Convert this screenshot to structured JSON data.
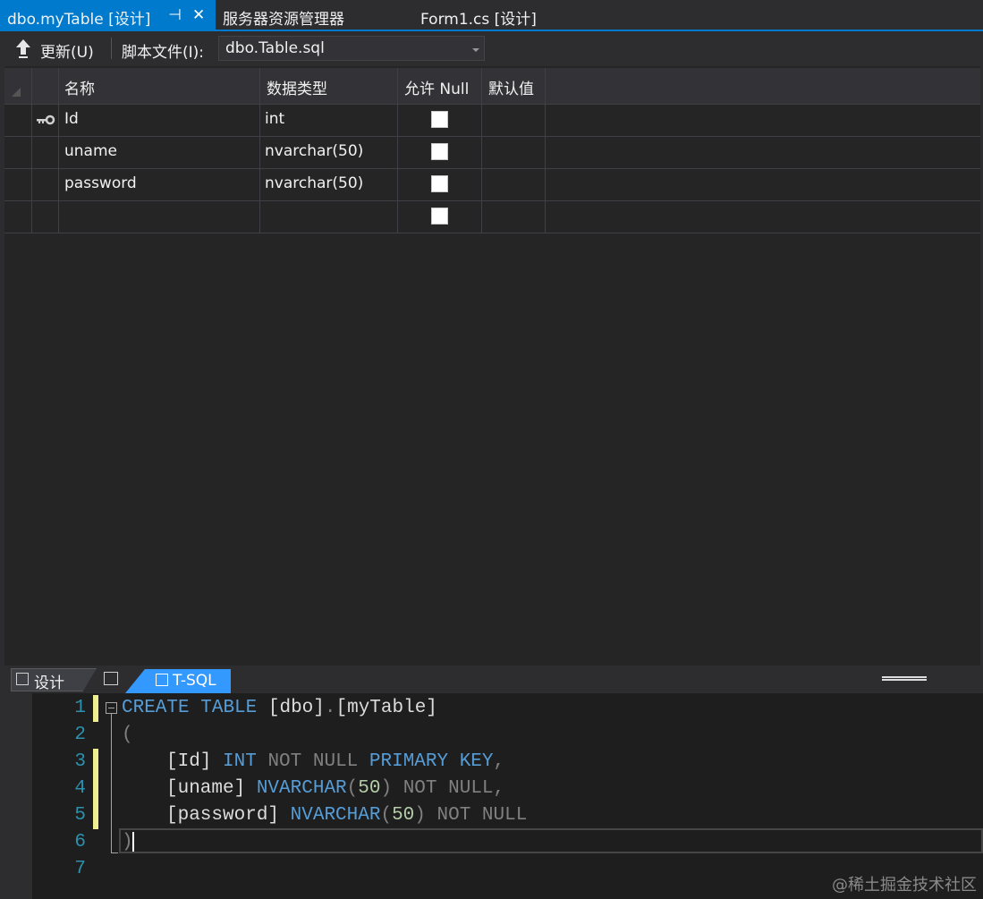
{
  "tabs": [
    {
      "label": "dbo.myTable [设计]",
      "active": true,
      "pin_glyph": "⊣",
      "close_glyph": "✕"
    },
    {
      "label": "服务器资源管理器",
      "active": false
    },
    {
      "label": "Form1.cs [设计]",
      "active": false
    }
  ],
  "toolbar": {
    "refresh_label": "更新(U)",
    "script_label": "脚本文件(I):",
    "script_file": "dbo.Table.sql"
  },
  "grid": {
    "columns": [
      "名称",
      "数据类型",
      "允许 Null",
      "默认值"
    ],
    "rows": [
      {
        "name": "Id",
        "type": "int",
        "allow_null": false,
        "primary_key": true
      },
      {
        "name": "uname",
        "type": "nvarchar(50)",
        "allow_null": false,
        "primary_key": false
      },
      {
        "name": "password",
        "type": "nvarchar(50)",
        "allow_null": false,
        "primary_key": false
      },
      {
        "name": "",
        "type": "",
        "allow_null": false,
        "primary_key": false
      }
    ]
  },
  "view_tabs": {
    "design_label": "设计",
    "tsql_label": "T-SQL",
    "active": "T-SQL"
  },
  "editor": {
    "line_numbers": [
      "1",
      "2",
      "3",
      "4",
      "5",
      "6",
      "7"
    ],
    "lines": [
      {
        "pre": "",
        "t1": "CREATE",
        "t2": " ",
        "t3": "TABLE",
        "t4": " ",
        "t5": "[dbo]",
        "t6": ".",
        "t7": "[myTable]"
      },
      {
        "paren": "("
      },
      {
        "col": "[Id]",
        "type": "INT",
        "rest1": "NOT NULL",
        "kw": "PRIMARY KEY",
        "end": ","
      },
      {
        "col": "[uname]",
        "type": "NVARCHAR",
        "lp": "(",
        "num": "50",
        "rp": ")",
        "rest1": "NOT NULL",
        "end": ","
      },
      {
        "col": "[password]",
        "type": "NVARCHAR",
        "lp": "(",
        "num": "50",
        "rp": ")",
        "rest1": "NOT NULL"
      },
      {
        "paren": ")"
      }
    ],
    "changed_lines": [
      1,
      3,
      4,
      5
    ]
  },
  "watermark": "@稀土掘金技术社区",
  "colors": {
    "accent": "#007acc",
    "tsql_tab": "#3399ff",
    "keyword": "#569cd6",
    "line_number": "#2b91af",
    "number": "#b5cea8",
    "change_marker": "#efef91"
  }
}
